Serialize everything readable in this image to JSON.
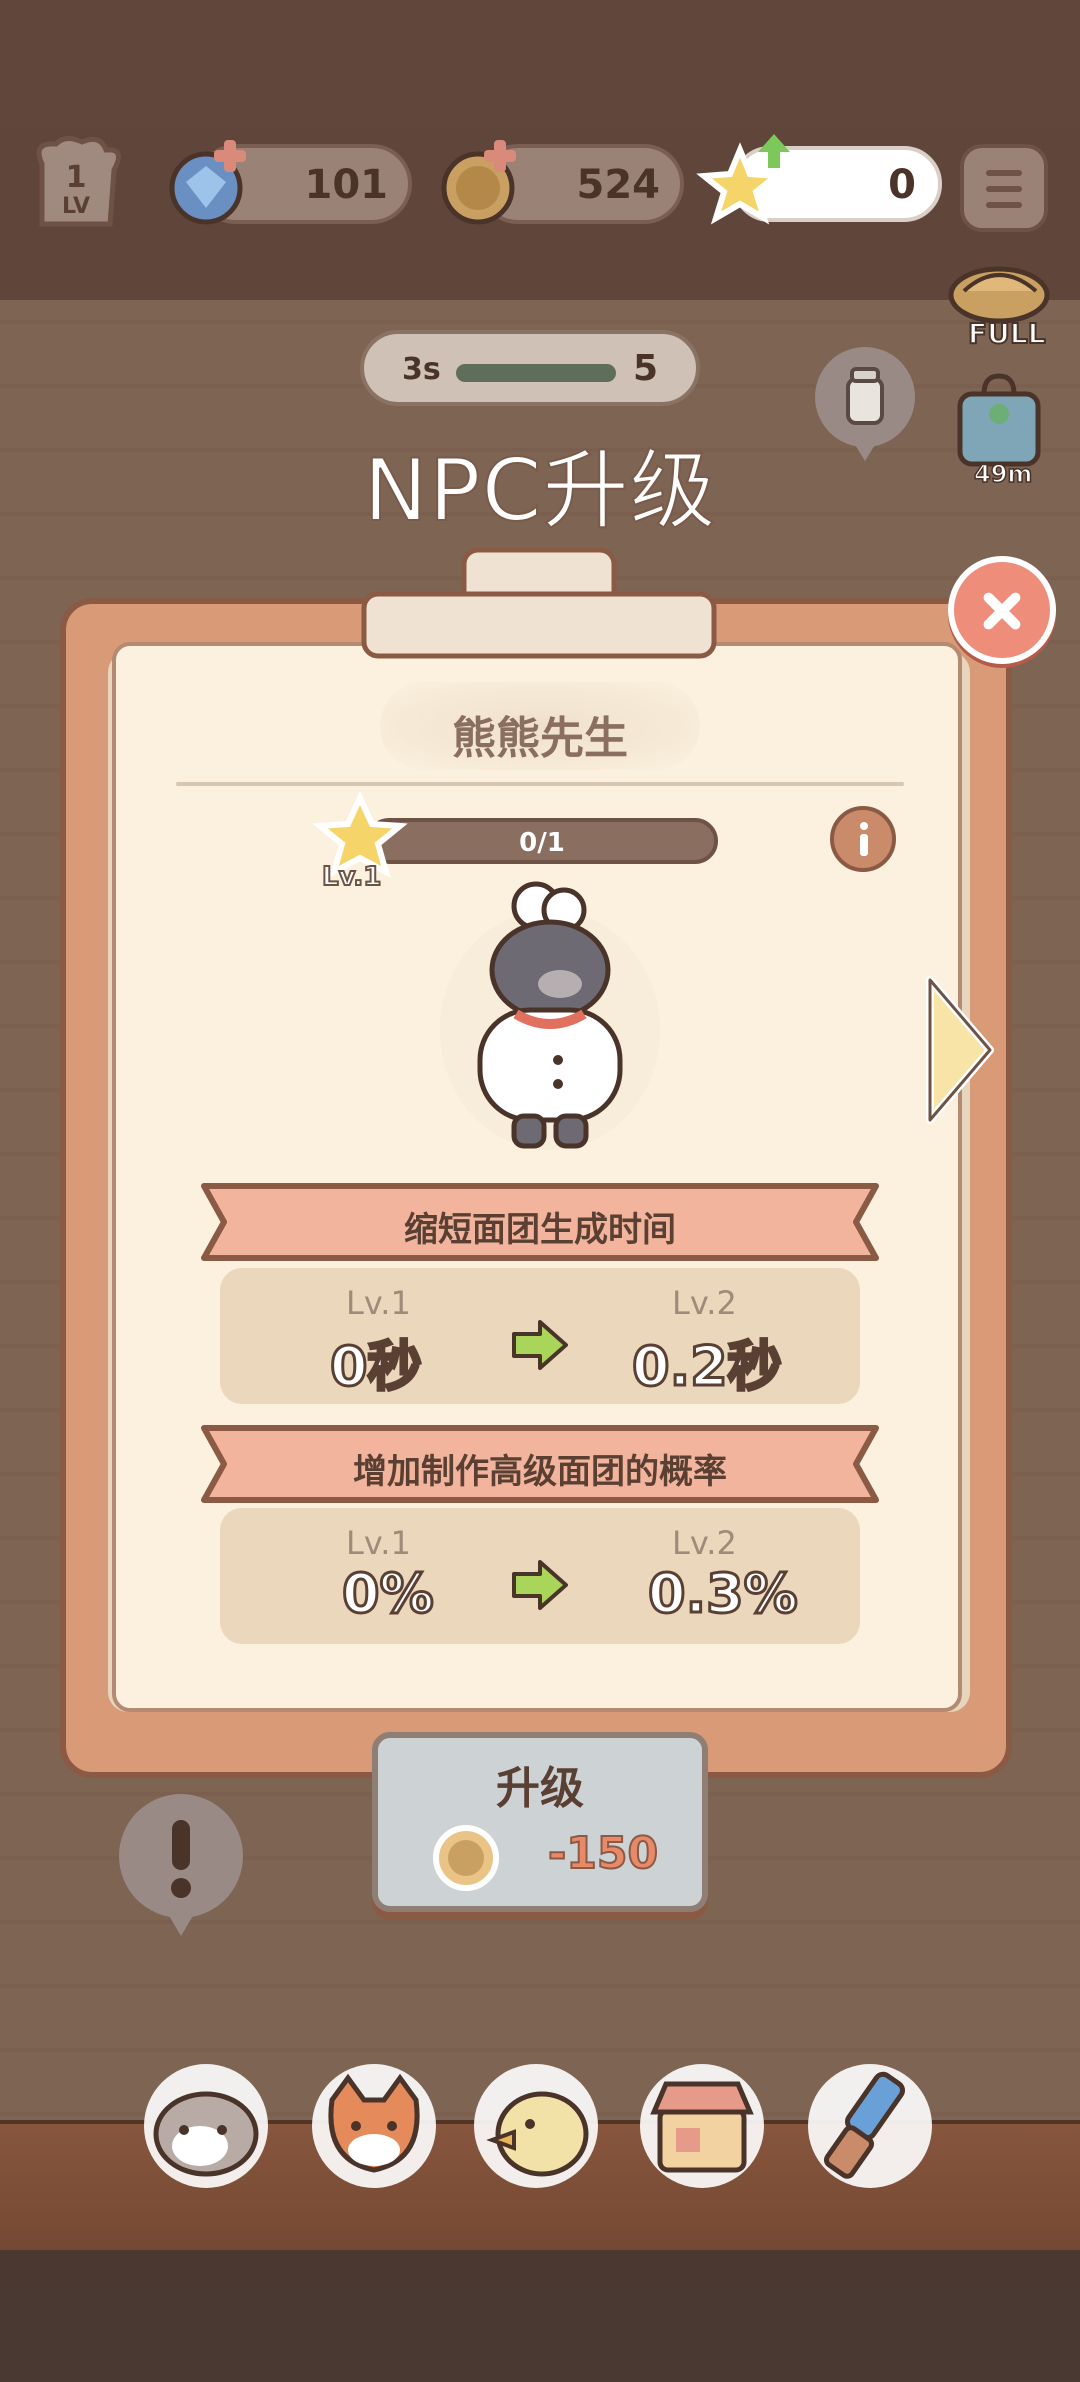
{
  "hud": {
    "level_value": "1",
    "level_label": "LV",
    "gems": "101",
    "coins": "524",
    "stars": "0"
  },
  "side": {
    "full_label": "FULL",
    "bag_timer": "49m"
  },
  "timer": {
    "seconds": "3s",
    "count": "5"
  },
  "title": "NPC升级",
  "npc": {
    "name": "熊熊先生",
    "progress": "0/1",
    "level": "Lv.1"
  },
  "skills": [
    {
      "title": "缩短面团生成时间",
      "from_level": "Lv.1",
      "from_value": "0秒",
      "to_level": "Lv.2",
      "to_value": "0.2秒"
    },
    {
      "title": "增加制作高级面团的概率",
      "from_level": "Lv.1",
      "from_value": "0%",
      "to_level": "Lv.2",
      "to_value": "0.3%"
    }
  ],
  "upgrade": {
    "label": "升级",
    "cost": "-150"
  },
  "colors": {
    "paper": "#fbf1de",
    "board": "#d99a78",
    "banner": "#f2b49c",
    "close": "#ef8d7b",
    "text_dark": "#5a3f33"
  },
  "icons": [
    "level-badge-icon",
    "gem-icon",
    "coin-icon",
    "star-icon",
    "menu-icon",
    "bread-basket-icon",
    "gift-bag-icon",
    "jar-icon",
    "close-icon",
    "info-icon",
    "right-arrow-icon",
    "green-arrow-icon",
    "alert-icon",
    "raccoon-tab-icon",
    "fox-tab-icon",
    "duck-tab-icon",
    "shop-tab-icon",
    "brush-tab-icon"
  ]
}
